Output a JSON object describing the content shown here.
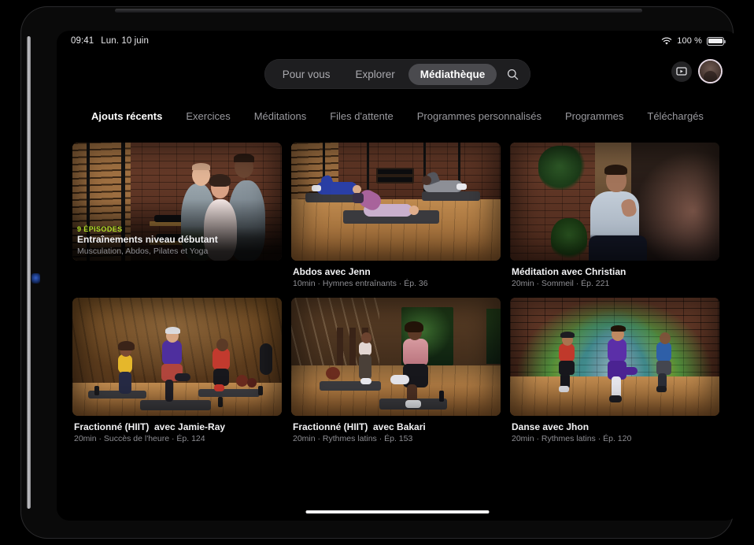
{
  "status_bar": {
    "time": "09:41",
    "date": "Lun. 10 juin",
    "battery_percent": "100 %",
    "wifi_icon": "wifi-icon",
    "battery_icon": "battery-icon"
  },
  "top_nav": {
    "pills": [
      {
        "label": "Pour vous",
        "active": false
      },
      {
        "label": "Explorer",
        "active": false
      },
      {
        "label": "Médiathèque",
        "active": true
      }
    ],
    "search_icon": "search-icon",
    "airplay_icon": "airplay-icon",
    "avatar_icon": "user-avatar"
  },
  "tabs": [
    {
      "label": "Ajouts récents",
      "active": true
    },
    {
      "label": "Exercices",
      "active": false
    },
    {
      "label": "Méditations",
      "active": false
    },
    {
      "label": "Files d'attente",
      "active": false
    },
    {
      "label": "Programmes personnalisés",
      "active": false
    },
    {
      "label": "Programmes",
      "active": false
    },
    {
      "label": "Téléchargés",
      "active": false
    }
  ],
  "cards": [
    {
      "eyebrow": "9 ÉPISODES",
      "title": "Entraînements niveau débutant",
      "subtitle": "Musculation, Abdos, Pilates et Yoga",
      "caption_overlay": true,
      "scene": "gym-trainers-group"
    },
    {
      "eyebrow": "",
      "title": "Abdos avec Jenn",
      "subtitle": "10min · Hymnes entraînants · Ép. 36",
      "caption_overlay": false,
      "scene": "core-class-mats"
    },
    {
      "eyebrow": "",
      "title": "Méditation avec Christian",
      "subtitle": "20min · Sommeil · Ép. 221",
      "caption_overlay": false,
      "scene": "meditation-seated"
    },
    {
      "eyebrow": "",
      "title": "Fractionné (HIIT)  avec Jamie-Ray",
      "subtitle": "20min · Succès de l'heure · Ép. 124",
      "caption_overlay": false,
      "scene": "hiit-three-people"
    },
    {
      "eyebrow": "",
      "title": "Fractionné (HIIT)  avec Bakari",
      "subtitle": "20min · Rythmes latins · Ép. 153",
      "caption_overlay": false,
      "scene": "hiit-two-people"
    },
    {
      "eyebrow": "",
      "title": "Danse avec Jhon",
      "subtitle": "20min · Rythmes latins · Ép. 120",
      "caption_overlay": false,
      "scene": "dance-colorful-backdrop"
    }
  ],
  "colors": {
    "accent_green": "#b2e02a",
    "active_pill": "#4a4a4e",
    "background": "#000000",
    "secondary_text": "#8e8e93"
  },
  "home_indicator": "home-indicator"
}
